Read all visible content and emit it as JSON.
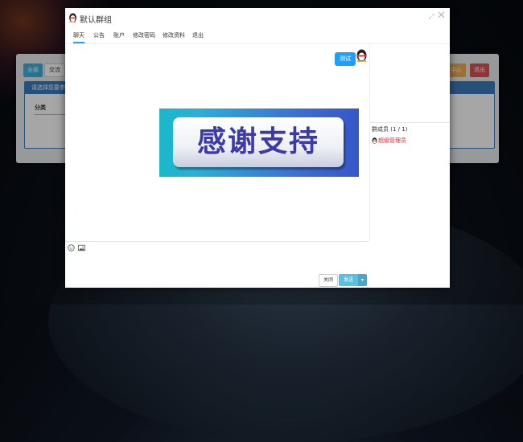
{
  "background": {
    "all_label": "全部",
    "exchange_label": "交流",
    "center_label": "中心",
    "quit_label": "退出",
    "box_header": "请选择您要参",
    "column": "分类"
  },
  "chat_window": {
    "title": "默认群组",
    "tabs": [
      {
        "label": "聊天",
        "active": true
      },
      {
        "label": "公告",
        "active": false
      },
      {
        "label": "账户",
        "active": false
      },
      {
        "label": "修改密码",
        "active": false
      },
      {
        "label": "修改资料",
        "active": false
      },
      {
        "label": "退出",
        "active": false
      }
    ],
    "message": {
      "text": "测试"
    },
    "image_text": "感谢支持",
    "members": {
      "title": "群成员 (1 / 1)",
      "items": [
        {
          "name": "超级管理员"
        }
      ]
    },
    "toolbar": {
      "emoji_icon": "smile-icon",
      "image_icon": "image-icon"
    },
    "buttons": {
      "close": "关闭",
      "send": "发送",
      "dropdown": "▾"
    }
  },
  "colors": {
    "accent": "#1e9fff",
    "send": "#5bc0de",
    "member": "#e22222"
  }
}
